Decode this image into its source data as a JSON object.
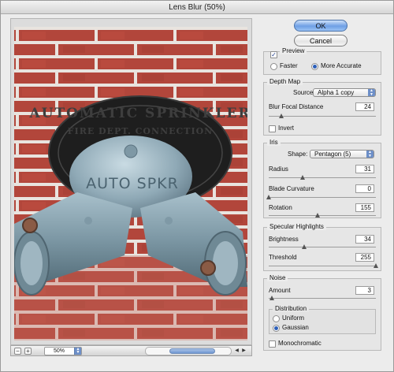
{
  "window": {
    "title": "Lens Blur (50%)"
  },
  "nav": {
    "zoom_value": "50%",
    "zoom_out": "−",
    "zoom_in": "+"
  },
  "buttons": {
    "ok": "OK",
    "cancel": "Cancel"
  },
  "preview": {
    "preview_label": "Preview",
    "preview_checked": true,
    "faster_label": "Faster",
    "more_accurate_label": "More Accurate",
    "selected": "More Accurate"
  },
  "depth_map": {
    "group_label": "Depth Map",
    "source_label": "Source:",
    "source_value": "Alpha 1 copy",
    "blur_focal_label": "Blur Focal Distance",
    "blur_focal_value": "24",
    "invert_label": "Invert",
    "invert_checked": false
  },
  "iris": {
    "group_label": "Iris",
    "shape_label": "Shape:",
    "shape_value": "Pentagon (5)",
    "radius_label": "Radius",
    "radius_value": "31",
    "blade_curvature_label": "Blade Curvature",
    "blade_curvature_value": "0",
    "rotation_label": "Rotation",
    "rotation_value": "155"
  },
  "specular": {
    "group_label": "Specular Highlights",
    "brightness_label": "Brightness",
    "brightness_value": "34",
    "threshold_label": "Threshold",
    "threshold_value": "255"
  },
  "noise": {
    "group_label": "Noise",
    "amount_label": "Amount",
    "amount_value": "3",
    "distribution_label": "Distribution",
    "uniform_label": "Uniform",
    "gaussian_label": "Gaussian",
    "selected": "Gaussian",
    "monochromatic_label": "Monochromatic",
    "monochromatic_checked": false
  },
  "photo": {
    "plate_text_top": "AUTOMATIC SPRINKLER",
    "plate_text_mid": "FIRE DEPT. CONNECTION",
    "body_text": "AUTO SPKR"
  },
  "colors": {
    "accent": "#6d8fc8",
    "brick": "#b4453a",
    "mortar": "#e8e2de"
  }
}
